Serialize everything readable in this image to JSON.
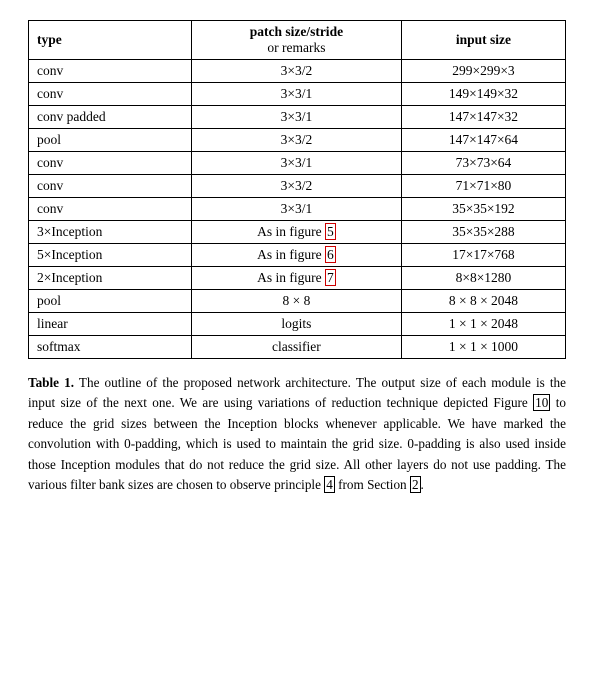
{
  "table": {
    "headers": {
      "col1": "type",
      "col2_main": "patch size/stride",
      "col2_sub": "or remarks",
      "col3": "input size"
    },
    "rows": [
      {
        "type": "conv",
        "patch": "3×3/2",
        "input": "299×299×3"
      },
      {
        "type": "conv",
        "patch": "3×3/1",
        "input": "149×149×32"
      },
      {
        "type": "conv padded",
        "patch": "3×3/1",
        "input": "147×147×32"
      },
      {
        "type": "pool",
        "patch": "3×3/2",
        "input": "147×147×64"
      },
      {
        "type": "conv",
        "patch": "3×3/1",
        "input": "73×73×64"
      },
      {
        "type": "conv",
        "patch": "3×3/2",
        "input": "71×71×80"
      },
      {
        "type": "conv",
        "patch": "3×3/1",
        "input": "35×35×192"
      },
      {
        "type": "3×Inception",
        "patch": "As in figure 5",
        "input": "35×35×288",
        "highlight_patch": "5"
      },
      {
        "type": "5×Inception",
        "patch": "As in figure 6",
        "input": "17×17×768",
        "highlight_patch": "6"
      },
      {
        "type": "2×Inception",
        "patch": "As in figure 7",
        "input": "8×8×1280",
        "highlight_patch": "7"
      },
      {
        "type": "pool",
        "patch": "8 × 8",
        "input": "8 × 8 × 2048"
      },
      {
        "type": "linear",
        "patch": "logits",
        "input": "1 × 1 × 2048"
      },
      {
        "type": "softmax",
        "patch": "classifier",
        "input": "1 × 1 × 1000"
      }
    ]
  },
  "caption": {
    "label": "Table 1.",
    "text": " The outline of the proposed network architecture.  The output size of each module is the input size of the next one.  We are using variations of reduction technique depicted Figure ",
    "ref10": "10",
    "text2": " to reduce the grid sizes between the Inception blocks whenever applicable.  We have marked the convolution with 0-padding, which is used to maintain the grid size.  0-padding is also used inside those Inception modules that do not reduce the grid size.  All other layers do not use padding.  The various filter bank sizes are chosen to observe principle ",
    "ref4": "4",
    "text3": " from Section ",
    "ref2": "2",
    "text4": "."
  }
}
